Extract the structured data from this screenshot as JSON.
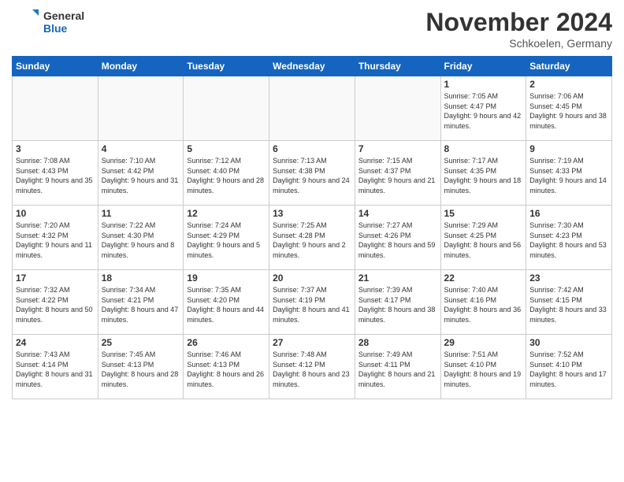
{
  "header": {
    "logo_line1": "General",
    "logo_line2": "Blue",
    "month_title": "November 2024",
    "location": "Schkoelen, Germany"
  },
  "weekdays": [
    "Sunday",
    "Monday",
    "Tuesday",
    "Wednesday",
    "Thursday",
    "Friday",
    "Saturday"
  ],
  "weeks": [
    [
      {
        "day": "",
        "empty": true
      },
      {
        "day": "",
        "empty": true
      },
      {
        "day": "",
        "empty": true
      },
      {
        "day": "",
        "empty": true
      },
      {
        "day": "",
        "empty": true
      },
      {
        "day": "1",
        "sunrise": "7:05 AM",
        "sunset": "4:47 PM",
        "daylight": "9 hours and 42 minutes."
      },
      {
        "day": "2",
        "sunrise": "7:06 AM",
        "sunset": "4:45 PM",
        "daylight": "9 hours and 38 minutes."
      }
    ],
    [
      {
        "day": "3",
        "sunrise": "7:08 AM",
        "sunset": "4:43 PM",
        "daylight": "9 hours and 35 minutes."
      },
      {
        "day": "4",
        "sunrise": "7:10 AM",
        "sunset": "4:42 PM",
        "daylight": "9 hours and 31 minutes."
      },
      {
        "day": "5",
        "sunrise": "7:12 AM",
        "sunset": "4:40 PM",
        "daylight": "9 hours and 28 minutes."
      },
      {
        "day": "6",
        "sunrise": "7:13 AM",
        "sunset": "4:38 PM",
        "daylight": "9 hours and 24 minutes."
      },
      {
        "day": "7",
        "sunrise": "7:15 AM",
        "sunset": "4:37 PM",
        "daylight": "9 hours and 21 minutes."
      },
      {
        "day": "8",
        "sunrise": "7:17 AM",
        "sunset": "4:35 PM",
        "daylight": "9 hours and 18 minutes."
      },
      {
        "day": "9",
        "sunrise": "7:19 AM",
        "sunset": "4:33 PM",
        "daylight": "9 hours and 14 minutes."
      }
    ],
    [
      {
        "day": "10",
        "sunrise": "7:20 AM",
        "sunset": "4:32 PM",
        "daylight": "9 hours and 11 minutes."
      },
      {
        "day": "11",
        "sunrise": "7:22 AM",
        "sunset": "4:30 PM",
        "daylight": "9 hours and 8 minutes."
      },
      {
        "day": "12",
        "sunrise": "7:24 AM",
        "sunset": "4:29 PM",
        "daylight": "9 hours and 5 minutes."
      },
      {
        "day": "13",
        "sunrise": "7:25 AM",
        "sunset": "4:28 PM",
        "daylight": "9 hours and 2 minutes."
      },
      {
        "day": "14",
        "sunrise": "7:27 AM",
        "sunset": "4:26 PM",
        "daylight": "8 hours and 59 minutes."
      },
      {
        "day": "15",
        "sunrise": "7:29 AM",
        "sunset": "4:25 PM",
        "daylight": "8 hours and 56 minutes."
      },
      {
        "day": "16",
        "sunrise": "7:30 AM",
        "sunset": "4:23 PM",
        "daylight": "8 hours and 53 minutes."
      }
    ],
    [
      {
        "day": "17",
        "sunrise": "7:32 AM",
        "sunset": "4:22 PM",
        "daylight": "8 hours and 50 minutes."
      },
      {
        "day": "18",
        "sunrise": "7:34 AM",
        "sunset": "4:21 PM",
        "daylight": "8 hours and 47 minutes."
      },
      {
        "day": "19",
        "sunrise": "7:35 AM",
        "sunset": "4:20 PM",
        "daylight": "8 hours and 44 minutes."
      },
      {
        "day": "20",
        "sunrise": "7:37 AM",
        "sunset": "4:19 PM",
        "daylight": "8 hours and 41 minutes."
      },
      {
        "day": "21",
        "sunrise": "7:39 AM",
        "sunset": "4:17 PM",
        "daylight": "8 hours and 38 minutes."
      },
      {
        "day": "22",
        "sunrise": "7:40 AM",
        "sunset": "4:16 PM",
        "daylight": "8 hours and 36 minutes."
      },
      {
        "day": "23",
        "sunrise": "7:42 AM",
        "sunset": "4:15 PM",
        "daylight": "8 hours and 33 minutes."
      }
    ],
    [
      {
        "day": "24",
        "sunrise": "7:43 AM",
        "sunset": "4:14 PM",
        "daylight": "8 hours and 31 minutes."
      },
      {
        "day": "25",
        "sunrise": "7:45 AM",
        "sunset": "4:13 PM",
        "daylight": "8 hours and 28 minutes."
      },
      {
        "day": "26",
        "sunrise": "7:46 AM",
        "sunset": "4:13 PM",
        "daylight": "8 hours and 26 minutes."
      },
      {
        "day": "27",
        "sunrise": "7:48 AM",
        "sunset": "4:12 PM",
        "daylight": "8 hours and 23 minutes."
      },
      {
        "day": "28",
        "sunrise": "7:49 AM",
        "sunset": "4:11 PM",
        "daylight": "8 hours and 21 minutes."
      },
      {
        "day": "29",
        "sunrise": "7:51 AM",
        "sunset": "4:10 PM",
        "daylight": "8 hours and 19 minutes."
      },
      {
        "day": "30",
        "sunrise": "7:52 AM",
        "sunset": "4:10 PM",
        "daylight": "8 hours and 17 minutes."
      }
    ]
  ]
}
